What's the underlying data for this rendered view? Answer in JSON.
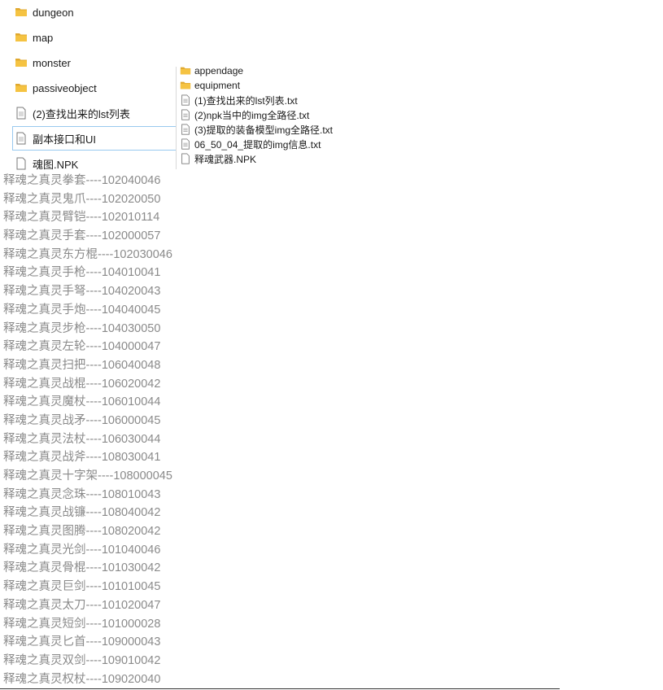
{
  "left_items": [
    {
      "type": "folder",
      "label": "dungeon"
    },
    {
      "type": "folder",
      "label": "map"
    },
    {
      "type": "folder",
      "label": "monster"
    },
    {
      "type": "folder",
      "label": "passiveobject"
    },
    {
      "type": "file",
      "label": "(2)查找出来的lst列表"
    },
    {
      "type": "file",
      "label": "副本接口和UI",
      "selected": true
    },
    {
      "type": "file",
      "label": "魂图.NPK"
    }
  ],
  "overlay_items": [
    {
      "type": "folder",
      "label": "appendage"
    },
    {
      "type": "folder",
      "label": "equipment"
    },
    {
      "type": "file",
      "label": "(1)查找出来的lst列表.txt"
    },
    {
      "type": "file",
      "label": "(2)npk当中的img全路径.txt"
    },
    {
      "type": "file",
      "label": "(3)提取的装备模型img全路径.txt"
    },
    {
      "type": "file",
      "label": "06_50_04_提取的img信息.txt"
    },
    {
      "type": "file",
      "label": "释魂武器.NPK"
    }
  ],
  "text_lines": [
    "释魂之真灵拳套----102040046",
    "释魂之真灵鬼爪----102020050",
    "释魂之真灵臂铠----102010114",
    "释魂之真灵手套----102000057",
    "释魂之真灵东方棍----102030046",
    "释魂之真灵手枪----104010041",
    "释魂之真灵手弩----104020043",
    "释魂之真灵手炮----104040045",
    "释魂之真灵步枪----104030050",
    "释魂之真灵左轮----104000047",
    "释魂之真灵扫把----106040048",
    "释魂之真灵战棍----106020042",
    "释魂之真灵魔杖----106010044",
    "释魂之真灵战矛----106000045",
    "释魂之真灵法杖----106030044",
    "释魂之真灵战斧----108030041",
    "释魂之真灵十字架----108000045",
    "释魂之真灵念珠----108010043",
    "释魂之真灵战镰----108040042",
    "释魂之真灵图腾----108020042",
    "释魂之真灵光剑----101040046",
    "释魂之真灵骨棍----101030042",
    "释魂之真灵巨剑----101010045",
    "释魂之真灵太刀----101020047",
    "释魂之真灵短剑----101000028",
    "释魂之真灵匕首----109000043",
    "释魂之真灵双剑----109010042",
    "释魂之真灵权杖----109020040"
  ],
  "colors": {
    "folder": "#f5c342",
    "folder_dark": "#e0a82e",
    "doc_border": "#7a7a7a",
    "selection": "#99c9ef",
    "text_gray": "#8a8a8a"
  }
}
